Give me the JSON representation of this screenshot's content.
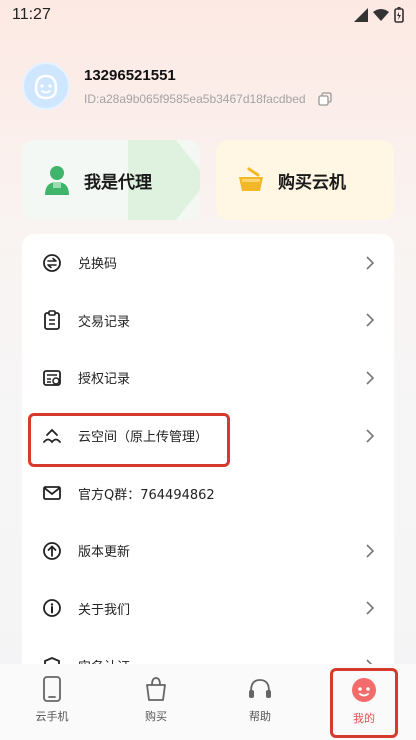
{
  "status_bar": {
    "time": "11:27"
  },
  "profile": {
    "phone": "13296521551",
    "id": "ID:a28a9b065f9585ea5b3467d18facdbed"
  },
  "cards": {
    "agent_label": "我是代理",
    "buy_label": "购买云机"
  },
  "menu": {
    "items": [
      {
        "label": "兑换码"
      },
      {
        "label": "交易记录"
      },
      {
        "label": "授权记录"
      },
      {
        "label": "云空间（原上传管理）"
      },
      {
        "label": "官方Q群：764494862"
      },
      {
        "label": "版本更新"
      },
      {
        "label": "关于我们"
      },
      {
        "label": "实名认证"
      }
    ]
  },
  "tabbar": {
    "tabs": [
      {
        "label": "云手机"
      },
      {
        "label": "购买"
      },
      {
        "label": "帮助"
      },
      {
        "label": "我的"
      }
    ]
  },
  "colors": {
    "accent_red": "#d53a2c",
    "agent_green": "#3fb46b",
    "buy_yellow": "#f2b829"
  }
}
